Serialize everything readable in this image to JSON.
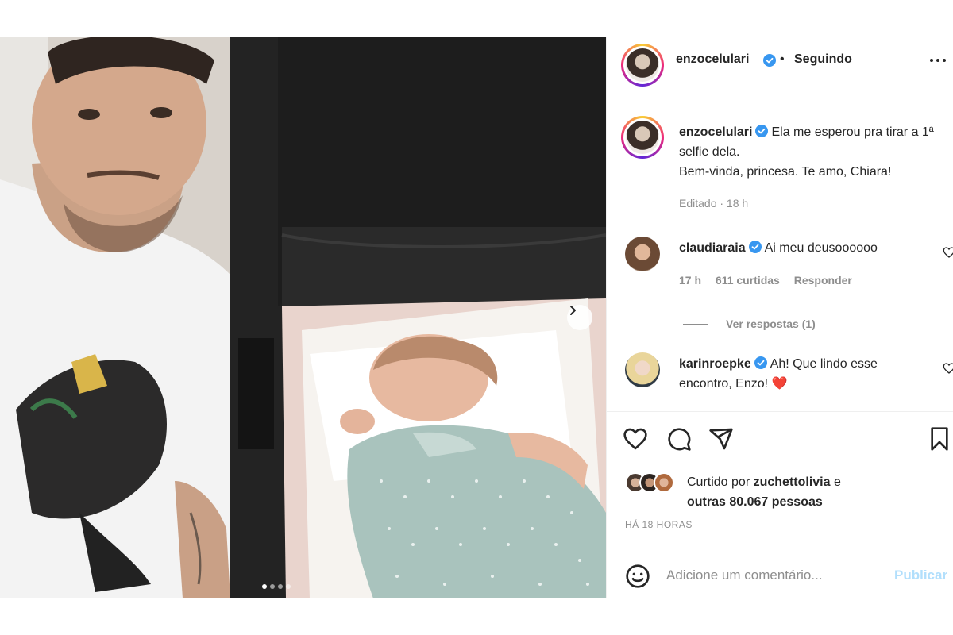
{
  "post": {
    "author": "enzocelulari",
    "separator": "•",
    "follow_status": "Seguindo",
    "more_icon": "more-horizontal-icon",
    "media_slide_count": 4,
    "media_active_slide": 1
  },
  "caption": {
    "username": "enzocelulari",
    "text_line1": "Ela me esperou pra tirar a 1ª selfie dela.",
    "text_line2": "Bem-vinda, princesa. Te amo, Chiara!",
    "meta": "Editado · 18 h"
  },
  "comments": [
    {
      "username": "claudiaraia",
      "text": "Ai meu deusoooooo",
      "time": "17 h",
      "likes": "611 curtidas",
      "reply_label": "Responder",
      "view_replies": "Ver respostas (1)"
    },
    {
      "username": "karinroepke",
      "text": "Ah! Que lindo esse encontro, Enzo! ",
      "emoji": "❤️"
    }
  ],
  "likes": {
    "prefix": "Curtido por",
    "user": "zuchettolivia",
    "connector": "e",
    "others": "outras 80.067 pessoas"
  },
  "timestamp": "HÁ 18 HORAS",
  "add_comment": {
    "placeholder": "Adicione um comentário...",
    "publish_label": "Publicar"
  },
  "colors": {
    "verified": "#3897f0",
    "publish_disabled": "#b2dffc",
    "secondary_text": "#8e8e8e",
    "heart_emoji": "#e0245e"
  }
}
